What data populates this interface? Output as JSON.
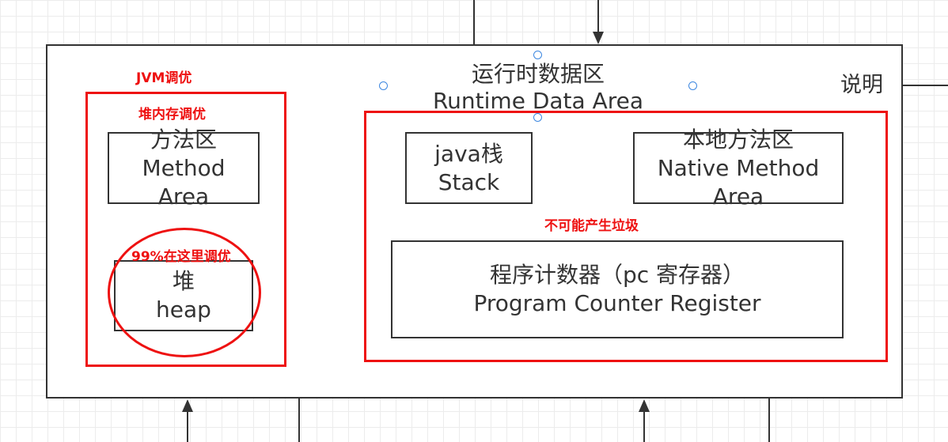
{
  "diagram": {
    "title": "运行时数据区\nRuntime Data Area",
    "note_label": "说明",
    "jvm_tuning_label": "JVM调优",
    "heap_tuning_label": "堆内存调优",
    "hotspot_label": "99%在这里调优",
    "no_garbage_label": "不可能产生垃圾",
    "method_area": "方法区\nMethod\nArea",
    "heap": "堆\nheap",
    "java_stack": "java栈\nStack",
    "native_method_area": "本地方法区\nNative Method\nArea",
    "program_counter": "程序计数器（pc 寄存器）\nProgram Counter Register"
  },
  "colors": {
    "annotation": "#ee1111",
    "border": "#333333",
    "selection_handle": "#3d87e0"
  }
}
